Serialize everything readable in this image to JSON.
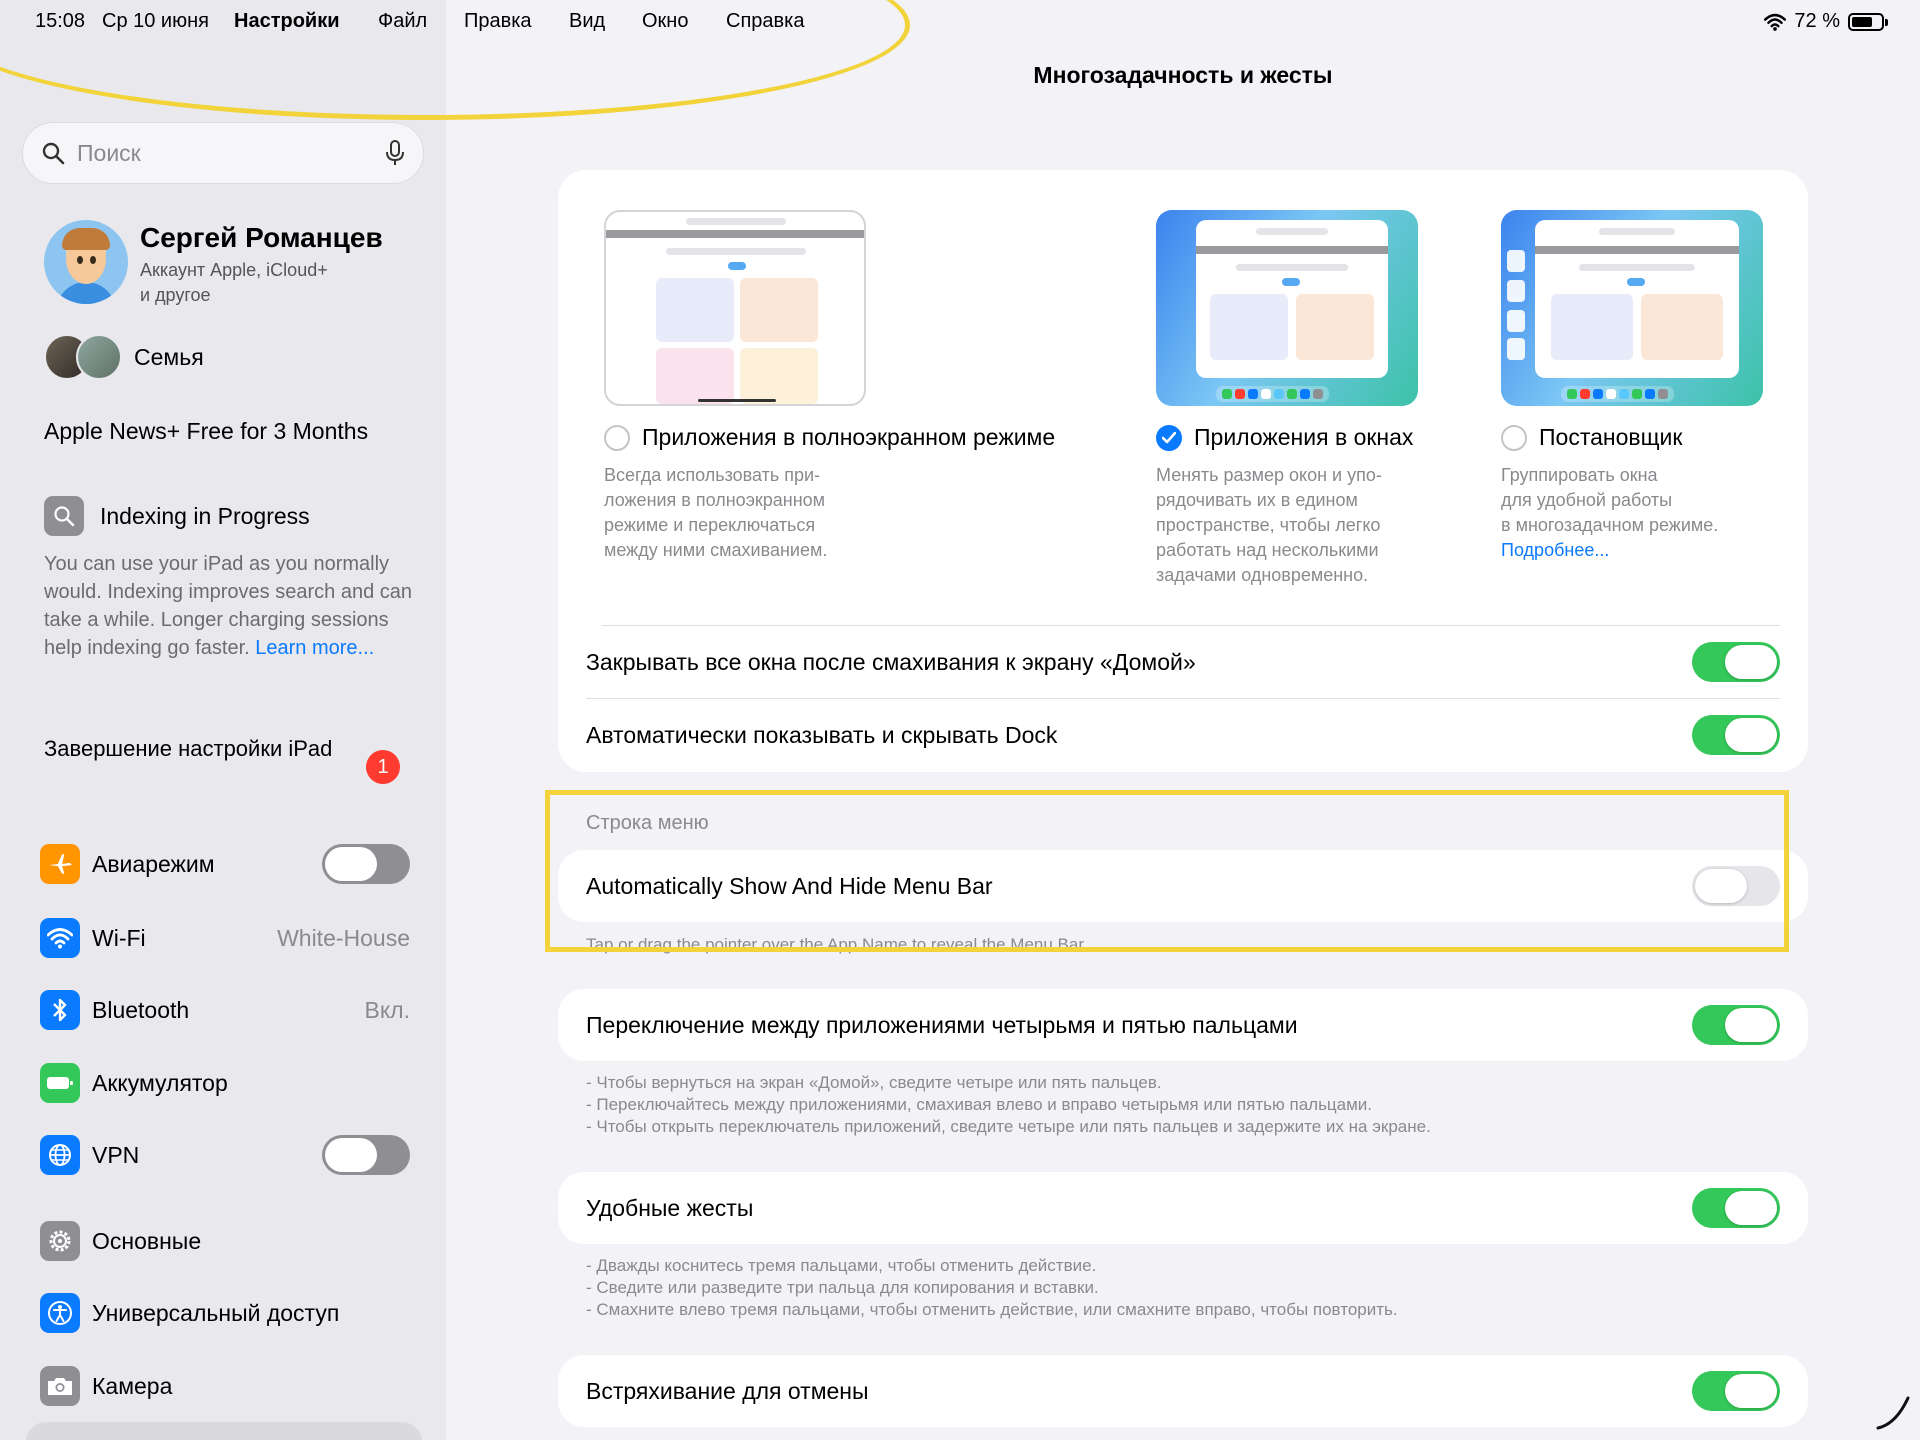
{
  "status_bar": {
    "time": "15:08",
    "date": "Ср 10 июня",
    "app_name": "Настройки",
    "menu": [
      "Файл",
      "Правка",
      "Вид",
      "Окно",
      "Справка"
    ],
    "battery": "72 %",
    "battery_level": 0.72
  },
  "sidebar": {
    "search_placeholder": "Поиск",
    "profile": {
      "name": "Сергей Романцев",
      "subtitle_line1": "Аккаунт Apple, iCloud+",
      "subtitle_line2": "и другое"
    },
    "family": "Семья",
    "news_promo": "Apple News+ Free for 3 Months",
    "indexing": {
      "title": "Indexing in Progress",
      "body": "You can use your iPad as you normally would. Indexing improves search and can take a while. Longer charging sessions help indexing go faster. ",
      "link": "Learn more..."
    },
    "finish_setup": "Завершение настройки iPad",
    "finish_badge": "1",
    "items": [
      {
        "label": "Авиарежим",
        "value": "",
        "icon": "airplane-icon",
        "color": "#ff9500",
        "toggle": "off"
      },
      {
        "label": "Wi-Fi",
        "value": "White-House",
        "icon": "wifi-icon",
        "color": "#0a7aff"
      },
      {
        "label": "Bluetooth",
        "value": "Вкл.",
        "icon": "bluetooth-icon",
        "color": "#0a7aff"
      },
      {
        "label": "Аккумулятор",
        "value": "",
        "icon": "battery-icon",
        "color": "#34c759"
      },
      {
        "label": "VPN",
        "value": "",
        "icon": "globe-icon",
        "color": "#0a7aff",
        "toggle": "off"
      },
      {
        "label": "Основные",
        "value": "",
        "icon": "gear-icon",
        "color": "#8e8e93"
      },
      {
        "label": "Универсальный доступ",
        "value": "",
        "icon": "accessibility-icon",
        "color": "#0a7aff"
      },
      {
        "label": "Камера",
        "value": "",
        "icon": "camera-icon",
        "color": "#8e8e93"
      }
    ]
  },
  "main": {
    "title": "Многозадачность и жесты",
    "options": [
      {
        "label": "Приложения в полноэкранном режиме",
        "selected": false,
        "desc": [
          "Всегда использовать при-",
          "ложения в полноэкранном",
          "режиме и переключаться",
          "между ними смахиванием."
        ],
        "link": ""
      },
      {
        "label": "Приложения в окнах",
        "selected": true,
        "desc": [
          "Менять размер окон и упо-",
          "рядочивать их в едином",
          "пространстве, чтобы легко",
          "работать над несколькими",
          "задачами одновременно."
        ],
        "link": ""
      },
      {
        "label": "Постановщик",
        "selected": false,
        "desc": [
          "Группировать окна",
          "для удобной работы",
          "в многозадачном режиме."
        ],
        "link": "Подробнее..."
      }
    ],
    "toggles1": [
      {
        "label": "Закрывать все окна после смахивания к экрану «Домой»",
        "state": "on"
      },
      {
        "label": "Автоматически показывать и скрывать Dock",
        "state": "on"
      }
    ],
    "menu_bar_section": {
      "header": "Строка меню",
      "label": "Automatically Show And Hide Menu Bar",
      "state": "off",
      "footer": "Tap or drag the pointer over the App Name to reveal the Menu Bar."
    },
    "four_five_finger": {
      "label": "Переключение между приложениями четырьмя и пятью пальцами",
      "state": "on",
      "footer": [
        "- Чтобы вернуться на экран «Домой», сведите четыре или пять пальцев.",
        "- Переключайтесь между приложениями, смахивая влево и вправо четырьмя или пятью пальцами.",
        "- Чтобы открыть переключатель приложений, сведите четыре или пять пальцев и задержите их на экране."
      ]
    },
    "gestures": {
      "label": "Удобные жесты",
      "state": "on",
      "footer": [
        "- Дважды коснитесь тремя пальцами, чтобы отменить действие.",
        "- Сведите или разведите три пальца для копирования и вставки.",
        "- Смахните влево тремя пальцами, чтобы отменить действие, или смахните вправо, чтобы повторить."
      ]
    },
    "shake": {
      "label": "Встряхивание для отмены",
      "state": "on"
    }
  },
  "colors": {
    "accent": "#0a7aff",
    "toggle_on": "#34c759",
    "highlight": "#f2d33a",
    "badge": "#ff3b30"
  }
}
